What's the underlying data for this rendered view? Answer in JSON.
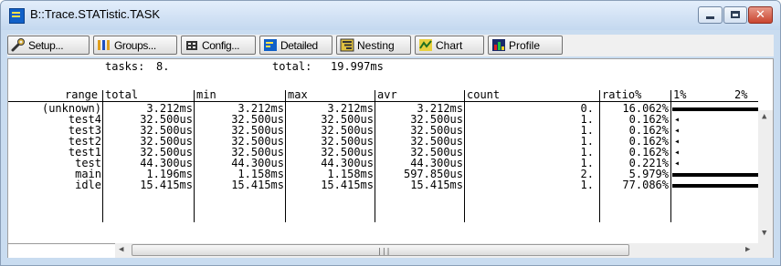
{
  "window": {
    "title": "B::Trace.STATistic.TASK"
  },
  "toolbar": {
    "setup_label": "Setup...",
    "groups_label": "Groups...",
    "config_label": "Config...",
    "detailed_label": "Detailed",
    "nesting_label": "Nesting",
    "chart_label": "Chart",
    "profile_label": "Profile"
  },
  "summary": {
    "tasks_label": "tasks:",
    "tasks_value": "8.",
    "total_label": "total:",
    "total_value": "19.997ms"
  },
  "columns": {
    "range": "range",
    "total": "total",
    "min": "min",
    "max": "max",
    "avr": "avr",
    "count": "count",
    "ratio": "ratio%",
    "scale_1": "1%",
    "scale_2": "2%"
  },
  "rows": [
    {
      "range": "(unknown)",
      "total": "3.212ms",
      "min": "3.212ms",
      "max": "3.212ms",
      "avr": "3.212ms",
      "count": "0.",
      "ratio": "16.062%",
      "ratio_value": 16.062
    },
    {
      "range": "test4",
      "total": "32.500us",
      "min": "32.500us",
      "max": "32.500us",
      "avr": "32.500us",
      "count": "1.",
      "ratio": "0.162%",
      "ratio_value": 0.162
    },
    {
      "range": "test3",
      "total": "32.500us",
      "min": "32.500us",
      "max": "32.500us",
      "avr": "32.500us",
      "count": "1.",
      "ratio": "0.162%",
      "ratio_value": 0.162
    },
    {
      "range": "test2",
      "total": "32.500us",
      "min": "32.500us",
      "max": "32.500us",
      "avr": "32.500us",
      "count": "1.",
      "ratio": "0.162%",
      "ratio_value": 0.162
    },
    {
      "range": "test1",
      "total": "32.500us",
      "min": "32.500us",
      "max": "32.500us",
      "avr": "32.500us",
      "count": "1.",
      "ratio": "0.162%",
      "ratio_value": 0.162
    },
    {
      "range": "test",
      "total": "44.300us",
      "min": "44.300us",
      "max": "44.300us",
      "avr": "44.300us",
      "count": "1.",
      "ratio": "0.221%",
      "ratio_value": 0.221
    },
    {
      "range": "main",
      "total": "1.196ms",
      "min": "1.158ms",
      "max": "1.158ms",
      "avr": "597.850us",
      "count": "2.",
      "ratio": "5.979%",
      "ratio_value": 5.979
    },
    {
      "range": "idle",
      "total": "15.415ms",
      "min": "15.415ms",
      "max": "15.415ms",
      "avr": "15.415ms",
      "count": "1.",
      "ratio": "77.086%",
      "ratio_value": 77.086
    }
  ],
  "scrollbar": {
    "grip_glyph": "|||"
  },
  "icons": [
    "app-icon",
    "setup-icon",
    "groups-icon",
    "config-icon",
    "detailed-icon",
    "nesting-icon",
    "chart-icon",
    "profile-icon",
    "minimize-icon",
    "maximize-icon",
    "close-icon"
  ]
}
